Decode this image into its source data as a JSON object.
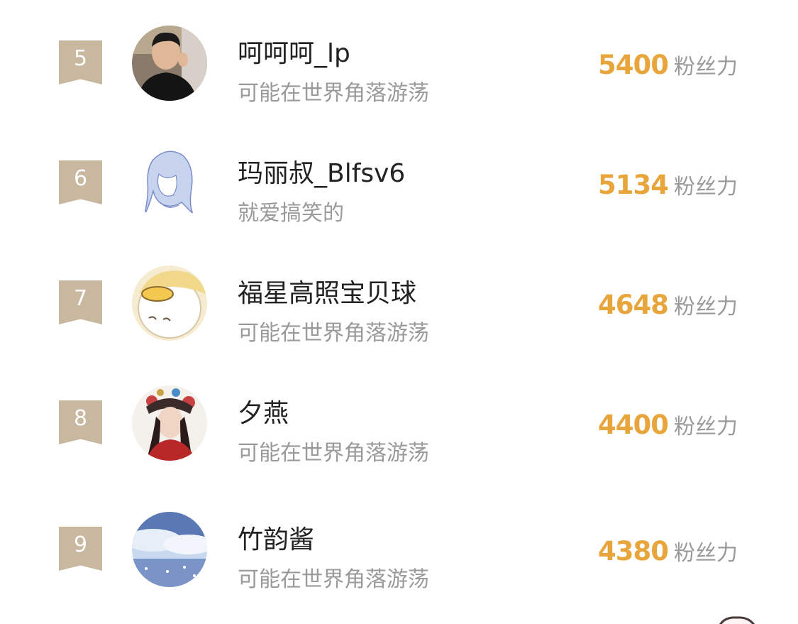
{
  "ranking": {
    "rows": [
      {
        "rank": "5",
        "name": "呵呵呵_lp",
        "bio": "可能在世界角落游荡",
        "score": "5400",
        "unit": "粉丝力",
        "avatar_icon": "avatar-photo-man"
      },
      {
        "rank": "6",
        "name": "玛丽叔_Blfsv6",
        "bio": "就爱搞笑的",
        "score": "5134",
        "unit": "粉丝力",
        "avatar_icon": "avatar-sketch-girl"
      },
      {
        "rank": "7",
        "name": "福星高照宝贝球",
        "bio": "可能在世界角落游荡",
        "score": "4648",
        "unit": "粉丝力",
        "avatar_icon": "avatar-duck"
      },
      {
        "rank": "8",
        "name": "夕燕",
        "bio": "可能在世界角落游荡",
        "score": "4400",
        "unit": "粉丝力",
        "avatar_icon": "avatar-opera-woman"
      },
      {
        "rank": "9",
        "name": "竹韵酱",
        "bio": "可能在世界角落游荡",
        "score": "4380",
        "unit": "粉丝力",
        "avatar_icon": "avatar-sky-landscape"
      }
    ]
  },
  "colors": {
    "rank_badge": "#c8b8a0",
    "score": "#e8a53c",
    "name": "#222222",
    "muted": "#9a9a9a"
  }
}
